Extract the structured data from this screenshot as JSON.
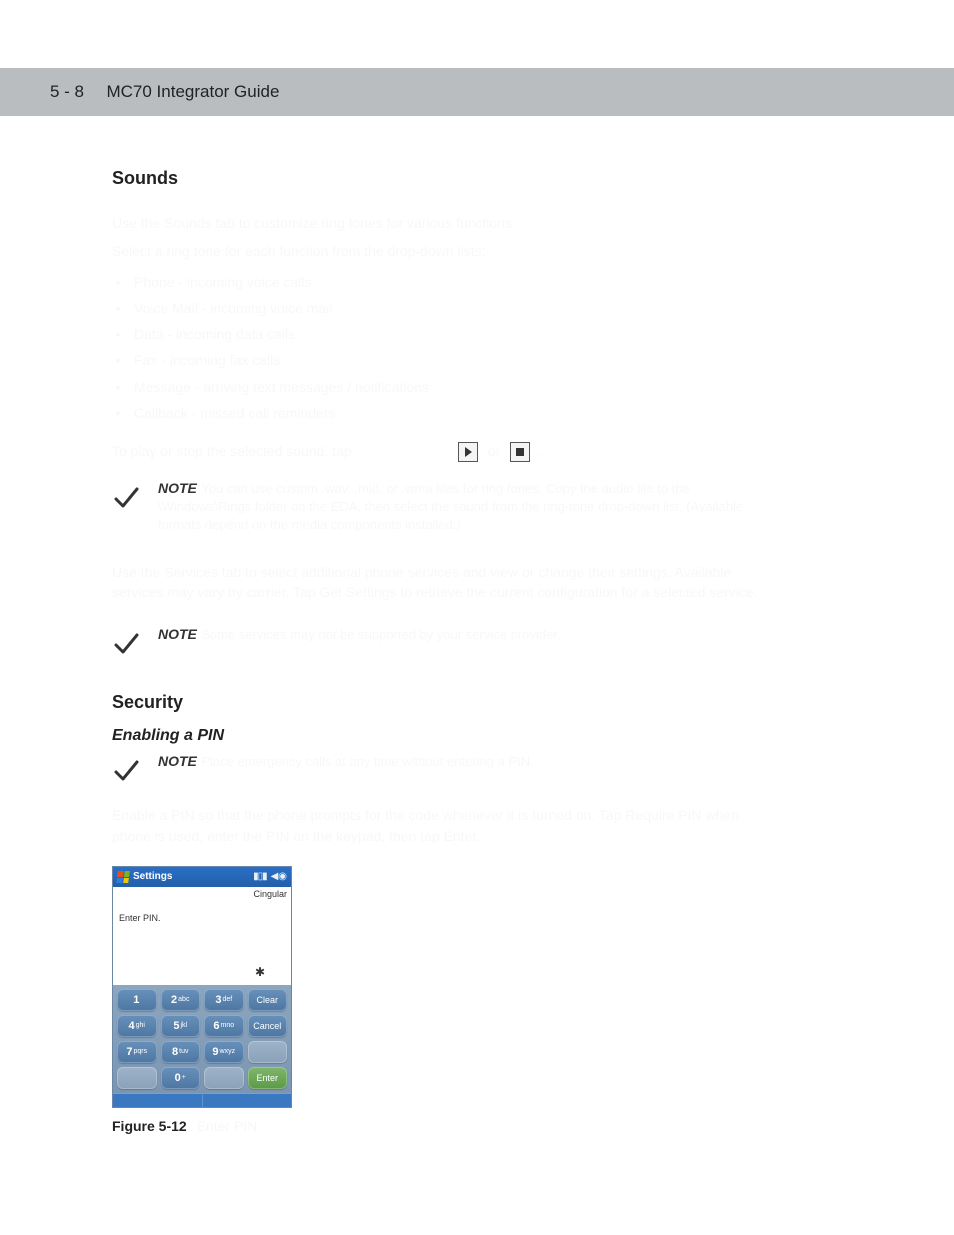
{
  "header": {
    "page_number": "5 - 8",
    "guide_title": "MC70 Integrator Guide"
  },
  "body": {
    "sounds": {
      "heading": "Sounds",
      "intro": "Use the Sounds tab to customize ring tones for various functions.",
      "list_intro": "Select a ring tone for each function from the drop-down lists:",
      "items": [
        "Phone - incoming voice calls",
        "Voice Mail - incoming voice mail",
        "Data - incoming data calls",
        "Fax - incoming fax calls",
        "Message - arriving text messages / notifications",
        "Callback - missed call reminders"
      ],
      "play_line_before": "To play or stop the selected sound, tap",
      "play_word_or": "or",
      "play_line_after": "."
    },
    "note1": {
      "label": "NOTE",
      "text": "You can use custom .wav, .mid, or .wma files for ring tones. Copy the audio file to the \\Windows\\Rings folder on the EDA, then select the sound from the ring-tone drop-down list. (Available formats depend on the media components installed.)"
    },
    "services_para": "Use the Services tab to select additional phone services and view or change their settings. Available services may vary by carrier. Tap Get Settings to retrieve the current configuration for a selected service.",
    "note2": {
      "label": "NOTE",
      "text": "Some services may not be supported by your service provider."
    },
    "security": {
      "heading": "Security",
      "sub": "Enabling a PIN"
    },
    "note3": {
      "label": "NOTE",
      "text": "Place emergency calls at any time without entering a PIN."
    },
    "enable_para": "Enable a PIN so that the phone prompts for the code whenever it is turned on. Tap Require PIN when phone is used, enter the PIN on the keypad, then tap Enter.",
    "device": {
      "titlebar": "Settings",
      "carrier": "Cingular",
      "prompt": "Enter PIN.",
      "masked": "✱",
      "keys": {
        "k1": {
          "num": "1",
          "let": ""
        },
        "k2": {
          "num": "2",
          "let": "abc"
        },
        "k3": {
          "num": "3",
          "let": "def"
        },
        "clear": "Clear",
        "k4": {
          "num": "4",
          "let": "ghi"
        },
        "k5": {
          "num": "5",
          "let": "jkl"
        },
        "k6": {
          "num": "6",
          "let": "mno"
        },
        "cancel": "Cancel",
        "k7": {
          "num": "7",
          "let": "pqrs"
        },
        "k8": {
          "num": "8",
          "let": "tuv"
        },
        "k9": {
          "num": "9",
          "let": "wxyz"
        },
        "k0": {
          "num": "0",
          "let": "+"
        },
        "enter": "Enter"
      }
    },
    "figure": {
      "num": "Figure 5-12",
      "caption": "Enter PIN"
    }
  }
}
